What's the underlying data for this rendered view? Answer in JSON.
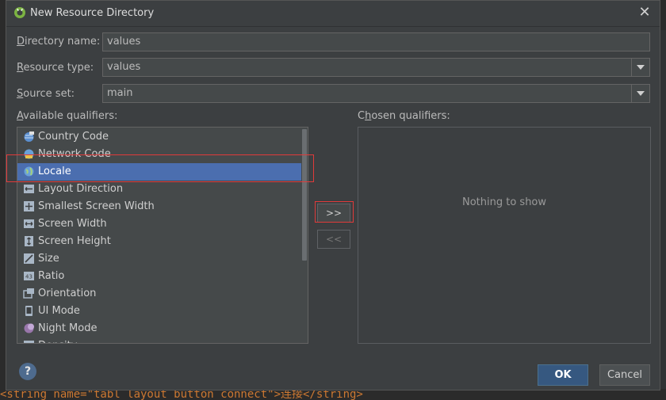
{
  "window": {
    "title": "New Resource Directory",
    "close_label": "✕"
  },
  "form": {
    "directory_name": {
      "label_first": "D",
      "label_rest": "irectory name:",
      "value": "values"
    },
    "resource_type": {
      "label_first": "R",
      "label_rest": "esource type:",
      "value": "values"
    },
    "source_set": {
      "label_first": "S",
      "label_rest": "ource set:",
      "value": "main"
    }
  },
  "available": {
    "label_first": "A",
    "label_rest": "vailable qualifiers:",
    "items": [
      {
        "label": "Country Code",
        "icon": "globe-flag-icon"
      },
      {
        "label": "Network Code",
        "icon": "network-icon"
      },
      {
        "label": "Locale",
        "icon": "globe-icon"
      },
      {
        "label": "Layout Direction",
        "icon": "layout-direction-icon"
      },
      {
        "label": "Smallest Screen Width",
        "icon": "smallest-width-icon"
      },
      {
        "label": "Screen Width",
        "icon": "screen-width-icon"
      },
      {
        "label": "Screen Height",
        "icon": "screen-height-icon"
      },
      {
        "label": "Size",
        "icon": "size-icon"
      },
      {
        "label": "Ratio",
        "icon": "ratio-icon"
      },
      {
        "label": "Orientation",
        "icon": "orientation-icon"
      },
      {
        "label": "UI Mode",
        "icon": "ui-mode-icon"
      },
      {
        "label": "Night Mode",
        "icon": "night-mode-icon"
      },
      {
        "label": "Density",
        "icon": "density-icon"
      }
    ],
    "selected_index": 2
  },
  "chosen": {
    "label_prefix": "C",
    "label_under": "h",
    "label_rest": "osen qualifiers:",
    "empty_text": "Nothing to show"
  },
  "buttons": {
    "add": ">>",
    "remove": "<<",
    "help": "?",
    "ok": "OK",
    "cancel": "Cancel"
  },
  "colors": {
    "selection": "#4b6eaf",
    "highlight_box": "#e03a3a",
    "ok_button": "#365880"
  }
}
